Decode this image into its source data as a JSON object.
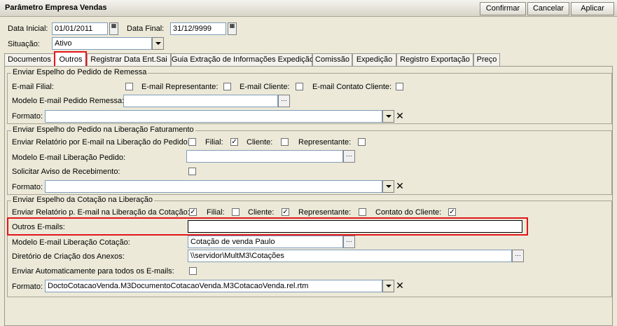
{
  "window": {
    "title": "Parâmetro Empresa Vendas"
  },
  "toolbar": {
    "confirm": "Confirmar",
    "cancel": "Cancelar",
    "apply": "Aplicar"
  },
  "header": {
    "start_label": "Data Inicial:",
    "start_value": "01/01/2011",
    "end_label": "Data Final:",
    "end_value": "31/12/9999",
    "status_label": "Situação:",
    "status_value": "Ativo"
  },
  "tabs": [
    {
      "label": "Documentos"
    },
    {
      "label": "Outros"
    },
    {
      "label": "Registrar Data Ent.Sai"
    },
    {
      "label": "Guia Extração de Informações Expedição"
    },
    {
      "label": "Comissão"
    },
    {
      "label": "Expedição"
    },
    {
      "label": "Registro Exportação"
    },
    {
      "label": "Preço"
    }
  ],
  "remessa": {
    "title": "Enviar Espelho do Pedido de Remessa",
    "email_filial": "E-mail Filial:",
    "email_rep": "E-mail Representante:",
    "email_cliente": "E-mail Cliente:",
    "email_contato": "E-mail Contato Cliente:",
    "modelo_label": "Modelo E-mail Pedido Remessa:",
    "modelo_value": "",
    "formato_label": "Formato:",
    "formato_value": ""
  },
  "faturamento": {
    "title": "Enviar Espelho do Pedido na Liberação Faturamento",
    "relatorio_label": "Enviar Relatório por E-mail na Liberação do Pedido:",
    "filial": "Filial:",
    "cliente": "Cliente:",
    "representante": "Representante:",
    "modelo_label": "Modelo E-mail Liberação Pedido:",
    "modelo_value": "",
    "aviso_label": "Solicitar Aviso de Recebimento:",
    "formato_label": "Formato:",
    "formato_value": ""
  },
  "cotacao": {
    "title": "Enviar Espelho da Cotação na Liberação",
    "relatorio_label": "Enviar Relatório p. E-mail na Liberação da Cotação:",
    "filial": "Filial:",
    "cliente": "Cliente:",
    "representante": "Representante:",
    "contato": "Contato do Cliente:",
    "outros_label": "Outros E-mails:",
    "outros_value": "",
    "modelo_label": "Modelo E-mail Liberação Cotação:",
    "modelo_value": "Cotação de venda Paulo",
    "diretorio_label": "Diretório de Criação dos Anexos:",
    "diretorio_value": "\\\\servidor\\MultM3\\Cotações",
    "auto_label": "Enviar Automaticamente para todos os E-mails:",
    "formato_label": "Formato:",
    "formato_value": "DoctoCotacaoVenda.M3DocumentoCotacaoVenda.M3CotacaoVenda.rel.rtm"
  },
  "icons": {
    "check": "✓",
    "clear": "✕",
    "dropdown": "chevron-down-icon",
    "browse": "ellipsis-icon"
  }
}
